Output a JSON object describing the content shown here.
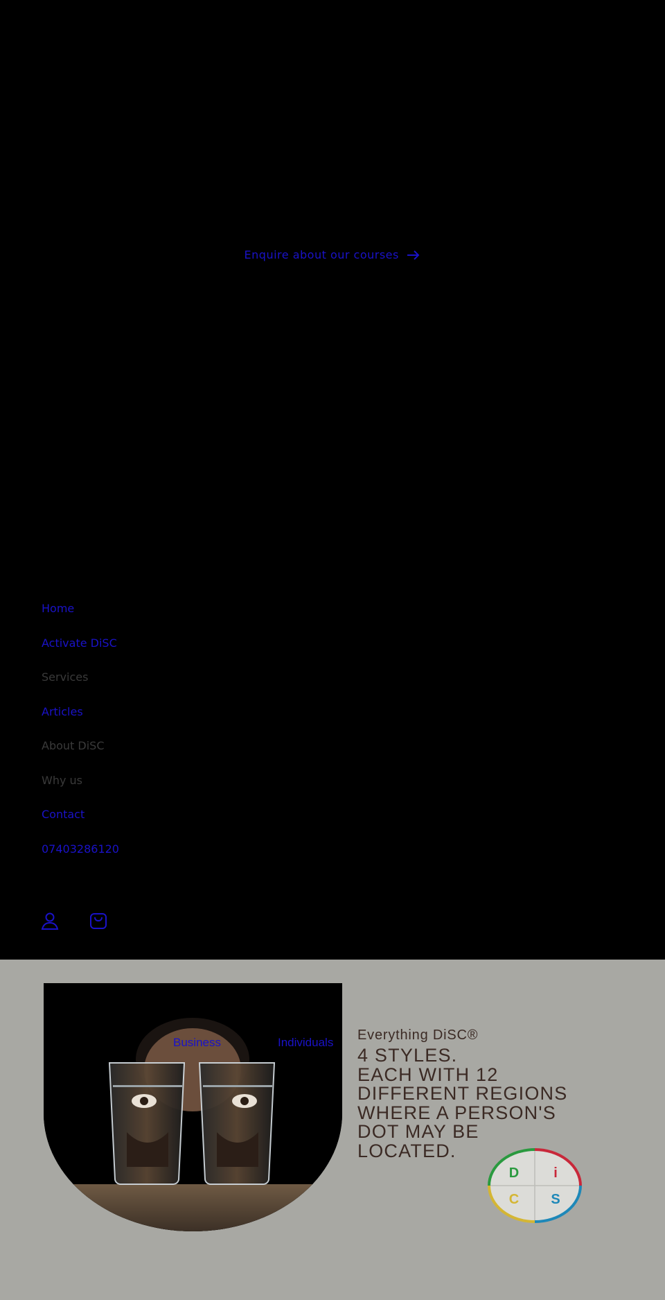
{
  "announcement": {
    "label": "Enquire about our courses",
    "arrow_icon": "arrow-right-icon"
  },
  "menu": {
    "items": [
      {
        "label": "Home",
        "link": true
      },
      {
        "label": "Activate DiSC",
        "link": true
      },
      {
        "label": "Services",
        "link": false
      },
      {
        "label": "Articles",
        "link": true
      },
      {
        "label": "About DiSC",
        "link": false
      },
      {
        "label": "Why us",
        "link": false
      },
      {
        "label": "Contact",
        "link": true
      },
      {
        "label": "07403286120",
        "link": true
      }
    ]
  },
  "header_icons": {
    "account": "account-icon",
    "cart": "cart-icon"
  },
  "feature": {
    "tabs": [
      "Business",
      "Individuals"
    ],
    "eyebrow": "Everything DiSC®",
    "heading_lines": [
      "4 STYLES.",
      "EACH WITH 12",
      "DIFFERENT REGIONS",
      "WHERE A PERSON'S",
      "DOT MAY BE",
      "LOCATED."
    ],
    "disc_letters": {
      "d": "D",
      "i": "i",
      "c": "C",
      "s": "S"
    }
  },
  "colors": {
    "link": "#1a12c8",
    "background_dark": "#000000",
    "feature_bg": "#a8a8a3",
    "heading_text": "#3b2a24",
    "disc_d": "#2a9a3f",
    "disc_i": "#c8283a",
    "disc_s": "#1e88b8",
    "disc_c": "#d4b634"
  }
}
